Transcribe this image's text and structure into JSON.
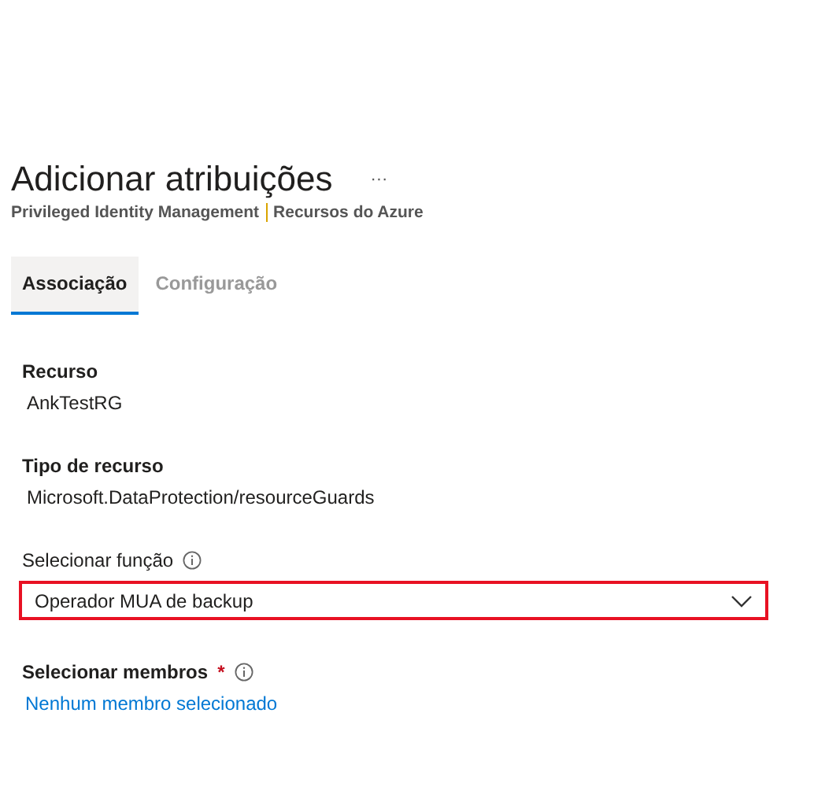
{
  "header": {
    "title": "Adicionar atribuições",
    "more": "···",
    "breadcrumb": [
      {
        "text": "Privileged Identity Management"
      },
      {
        "text": "Recursos do Azure"
      }
    ]
  },
  "tabs": [
    {
      "label": "Associação",
      "selected": true
    },
    {
      "label": "Configuração",
      "selected": false
    }
  ],
  "fields": [
    {
      "kind": "readonly",
      "label": "Recurso",
      "value": "AnkTestRG"
    },
    {
      "kind": "readonly",
      "label": "Tipo de recurso",
      "value": "Microsoft.DataProtection/resourceGuards"
    },
    {
      "kind": "dropdown",
      "label": "Selecionar função",
      "info": true,
      "value": "Operador MUA de backup",
      "highlighted": true
    },
    {
      "kind": "link",
      "label": "Selecionar membros",
      "info": true,
      "required_mark": "*",
      "value": "Nenhum membro selecionado"
    }
  ]
}
